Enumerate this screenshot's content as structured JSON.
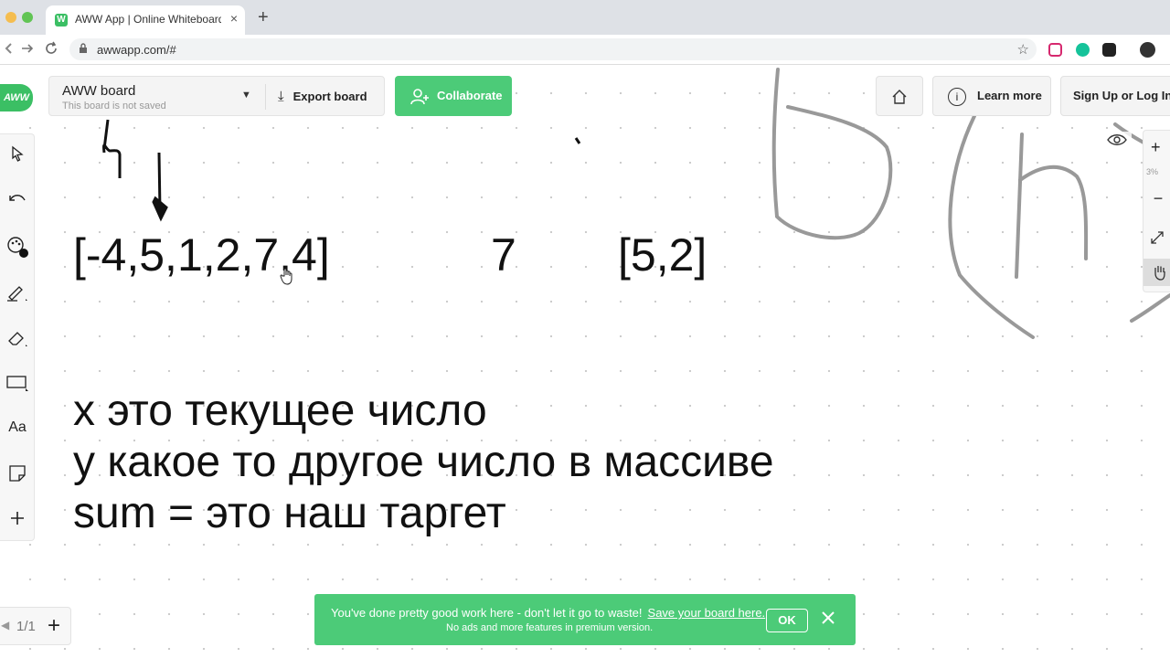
{
  "browser": {
    "tab_title": "AWW App | Online Whiteboard",
    "tab_close": "×",
    "new_tab": "+",
    "url": "awwapp.com/#",
    "favicon": "W"
  },
  "app": {
    "logo": "AWW",
    "board_name": "AWW board",
    "board_status": "This board is not saved",
    "export_label": "Export board",
    "collaborate_label": "Collaborate",
    "learn_more_label": "Learn more",
    "signup_label": "Sign Up or Log In",
    "zoom_level": "3%",
    "page_indicator": "1/1",
    "accent_color": "#4ccb78"
  },
  "toolbar": {
    "text_tool_label": "Aa"
  },
  "canvas": {
    "array_1": "[-4,5,1,2,7,4]",
    "target_value": "7",
    "array_2": "[5,2]",
    "notes": [
      "x это текущее число",
      "y какое то другое число в массиве",
      "sum = это наш таргет"
    ]
  },
  "toast": {
    "message": "You've done pretty good work here - don't let it go to waste!",
    "link": "Save your board here.",
    "sub": "No ads and more features in premium version.",
    "ok_label": "OK"
  }
}
